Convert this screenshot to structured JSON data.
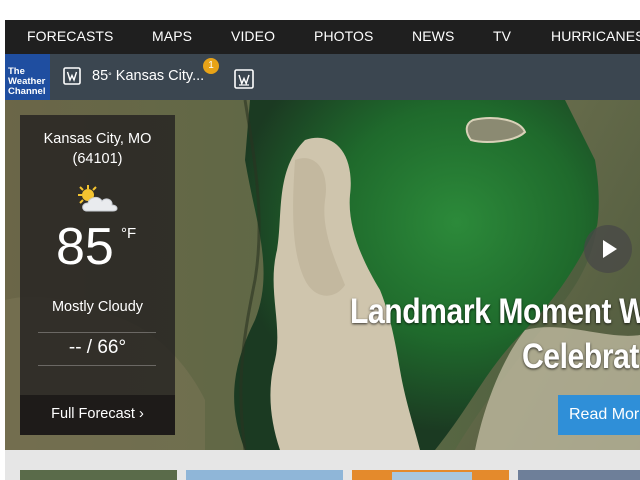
{
  "nav": {
    "items": [
      "FORECASTS",
      "MAPS",
      "VIDEO",
      "PHOTOS",
      "NEWS",
      "TV",
      "HURRICANES"
    ]
  },
  "brand": {
    "logo_line1": "The",
    "logo_line2": "Weather",
    "logo_line3": "Channel",
    "color": "#1f4ea0"
  },
  "location_bar": {
    "saved_location": "85° Kansas City...",
    "temp": "85",
    "degree": "°",
    "city": "Kansas City...",
    "notification_count": "1",
    "icons": [
      "location-pin-icon",
      "add-location-icon"
    ]
  },
  "weather": {
    "city": "Kansas City, MO",
    "zip": "(64101)",
    "condition_icon": "partly-cloudy-icon",
    "temperature": "85",
    "unit": "°F",
    "condition": "Mostly Cloudy",
    "hi_lo": "-- / 66°",
    "full_forecast": "Full Forecast ›"
  },
  "hero": {
    "headline_line1": "Landmark Moment W",
    "headline_line2": "Celebrat",
    "read_more": "Read More",
    "play_icon": "play-icon"
  },
  "colors": {
    "nav_bg": "#1f1f1f",
    "location_bar_bg": "#3b4650",
    "accent_blue": "#2f8fd8",
    "badge": "#e8a317"
  }
}
